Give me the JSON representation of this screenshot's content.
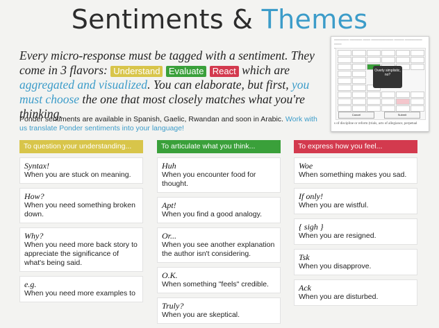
{
  "header": {
    "title_main": "Sentiments & ",
    "title_accent": "Themes"
  },
  "intro": {
    "p1": "Every micro-response must be tagged with a sentiment. They come in 3 flavors: ",
    "tag_understand": "Understand",
    "tag_evaluate": "Evaluate",
    "tag_react": "React",
    "p2": " which are ",
    "link1": "aggregated and visualized",
    "p3": ". You can elaborate, but first, ",
    "link2": "you must choose",
    "p4": " the one that most closely matches what you're thinking."
  },
  "note": {
    "text": "Ponder sentiments are available in Spanish, Gaelic, Rwandan and soon in Arabic. ",
    "link": "Work with us translate Ponder sentiments into your language!"
  },
  "colors": {
    "understand": "#d8c54a",
    "evaluate": "#3aa03a",
    "react": "#d33a4e",
    "accent": "#3c9cc9"
  },
  "columns": [
    {
      "heading": "To question your understanding...",
      "cards": [
        {
          "term": "Syntax!",
          "desc": "When you are stuck on meaning."
        },
        {
          "term": "How?",
          "desc": "When you need something broken down."
        },
        {
          "term": "Why?",
          "desc": "When you need more back story to appreciate the significance of what's being said."
        },
        {
          "term": "e.g.",
          "desc": "When you need more examples to"
        }
      ]
    },
    {
      "heading": "To articulate what you think...",
      "cards": [
        {
          "term": "Huh",
          "desc": "When you encounter food for thought."
        },
        {
          "term": "Apt!",
          "desc": "When you find a good analogy."
        },
        {
          "term": "Or...",
          "desc": "When you see another explanation the author isn't considering."
        },
        {
          "term": "O.K.",
          "desc": "When something \"feels\" credible."
        },
        {
          "term": "Truly?",
          "desc": "When you are skeptical."
        }
      ]
    },
    {
      "heading": "To express how you feel...",
      "cards": [
        {
          "term": "Woe",
          "desc": "When something makes you sad."
        },
        {
          "term": "If only!",
          "desc": "When you are wistful."
        },
        {
          "term": "{ sigh }",
          "desc": "When you are resigned."
        },
        {
          "term": "Tsk",
          "desc": "When you disapprove."
        },
        {
          "term": "Ack",
          "desc": "When you are disturbed."
        }
      ]
    }
  ],
  "preview": {
    "tooltip": "Overly simplistic, no?",
    "cancel": "Cancel",
    "submit": "Submit",
    "footer_text": "s of discipline or reform (trials, acts of allegiance, perpetual"
  }
}
